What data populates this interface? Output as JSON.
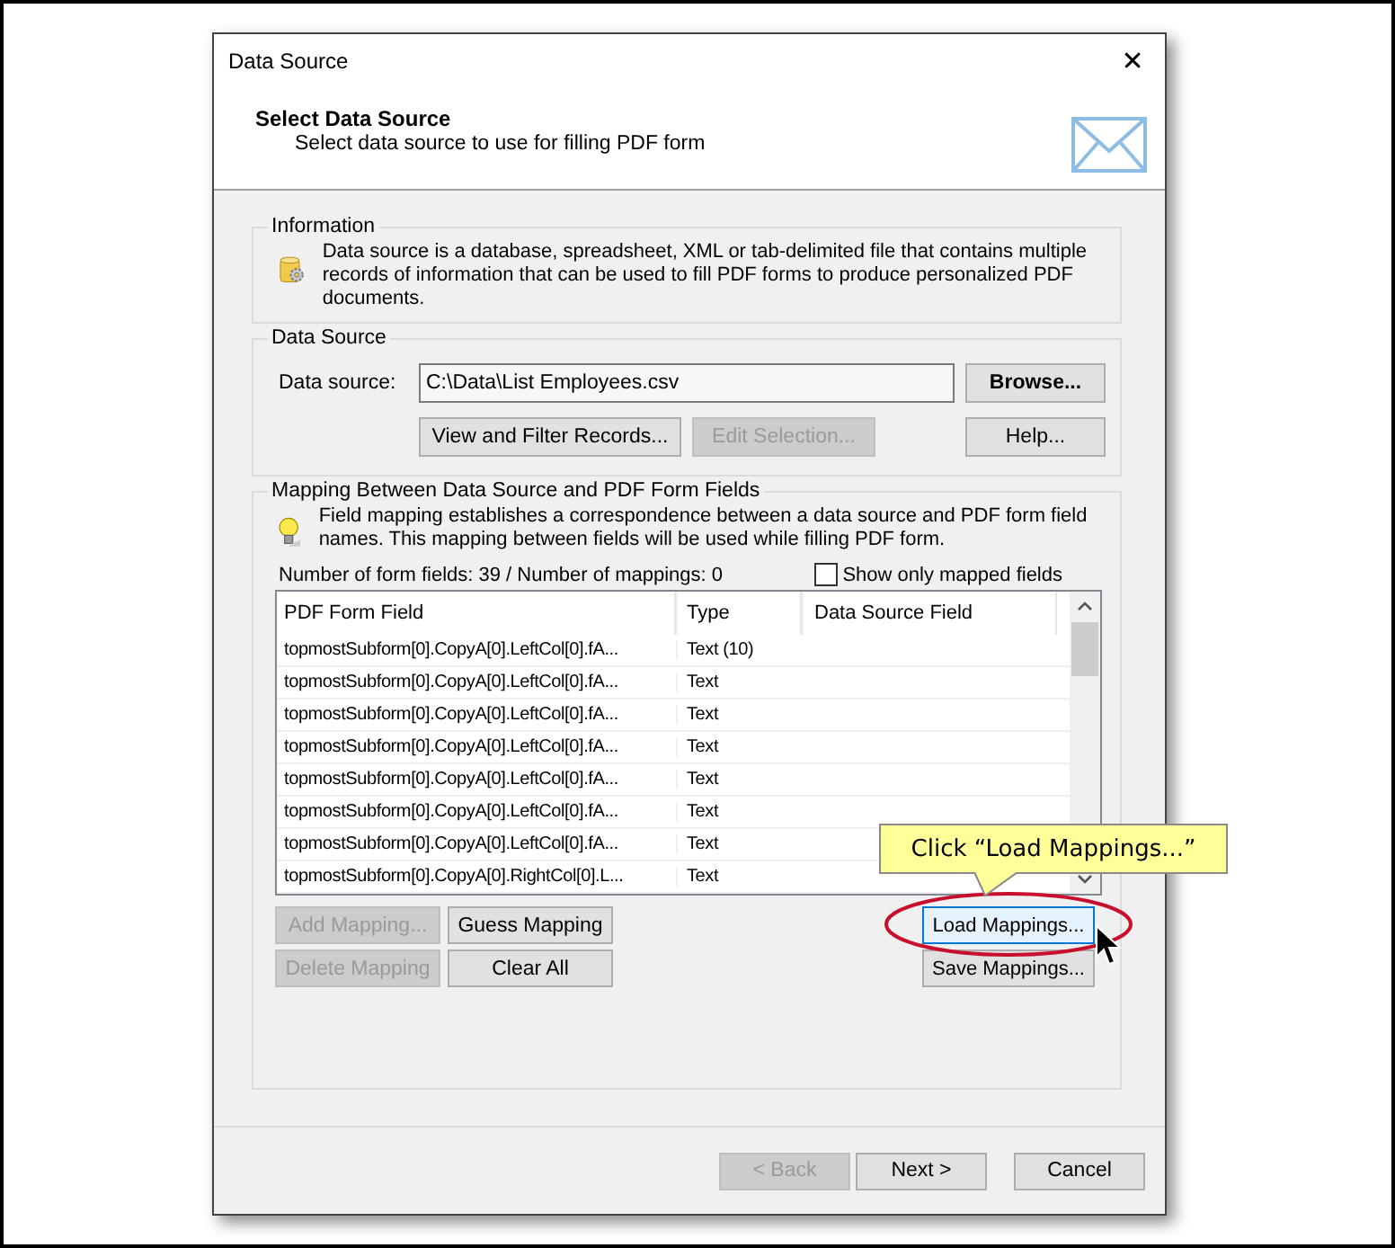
{
  "window": {
    "title": "Data Source",
    "close": "✕"
  },
  "header": {
    "title": "Select Data Source",
    "subtitle": "Select data source to use for filling PDF form"
  },
  "information": {
    "legend": "Information",
    "text": "Data source is a database, spreadsheet, XML or tab-delimited file that contains multiple records of information that can be used to fill PDF forms to produce personalized PDF documents."
  },
  "data_source": {
    "legend": "Data Source",
    "label": "Data source:",
    "value": "C:\\Data\\List Employees.csv",
    "buttons": [
      {
        "label": "Browse...",
        "disabled": false,
        "default": true
      },
      {
        "label": "View and Filter Records...",
        "disabled": false,
        "default": false
      },
      {
        "label": "Edit Selection...",
        "disabled": true,
        "default": false
      },
      {
        "label": "Help...",
        "disabled": false,
        "default": false
      }
    ]
  },
  "mapping": {
    "legend": "Mapping Between Data Source and PDF Form Fields",
    "text": "Field mapping establishes a correspondence between a data source and PDF form field names. This mapping between fields will be used while filling PDF form.",
    "counts": "Number of form fields: 39 / Number of mappings: 0",
    "show_only_mapped": {
      "label": "Show only mapped fields",
      "checked": false
    },
    "table": {
      "columns": [
        "PDF Form Field",
        "Type",
        "Data Source Field"
      ],
      "rows": [
        {
          "field": "topmostSubform[0].CopyA[0].LeftCol[0].fA...",
          "type": "Text (10)"
        },
        {
          "field": "topmostSubform[0].CopyA[0].LeftCol[0].fA...",
          "type": "Text"
        },
        {
          "field": "topmostSubform[0].CopyA[0].LeftCol[0].fA...",
          "type": "Text"
        },
        {
          "field": "topmostSubform[0].CopyA[0].LeftCol[0].fA...",
          "type": "Text"
        },
        {
          "field": "topmostSubform[0].CopyA[0].LeftCol[0].fA...",
          "type": "Text"
        },
        {
          "field": "topmostSubform[0].CopyA[0].LeftCol[0].fA...",
          "type": "Text"
        },
        {
          "field": "topmostSubform[0].CopyA[0].LeftCol[0].fA...",
          "type": "Text"
        },
        {
          "field": "topmostSubform[0].CopyA[0].RightCol[0].L...",
          "type": "Text"
        }
      ]
    },
    "left_buttons": [
      {
        "label": "Add Mapping...",
        "disabled": true
      },
      {
        "label": "Guess Mapping",
        "disabled": false
      },
      {
        "label": "Delete Mapping",
        "disabled": true
      },
      {
        "label": "Clear All",
        "disabled": false
      }
    ],
    "right_buttons": [
      {
        "label": "Load Mappings...",
        "focused": true
      },
      {
        "label": "Save Mappings...",
        "focused": false
      }
    ]
  },
  "callout": {
    "text": "Click “Load Mappings...”"
  },
  "footer_buttons": [
    {
      "label": "< Back",
      "disabled": true
    },
    {
      "label": "Next >",
      "disabled": false
    },
    {
      "label": "Cancel",
      "disabled": false
    }
  ]
}
